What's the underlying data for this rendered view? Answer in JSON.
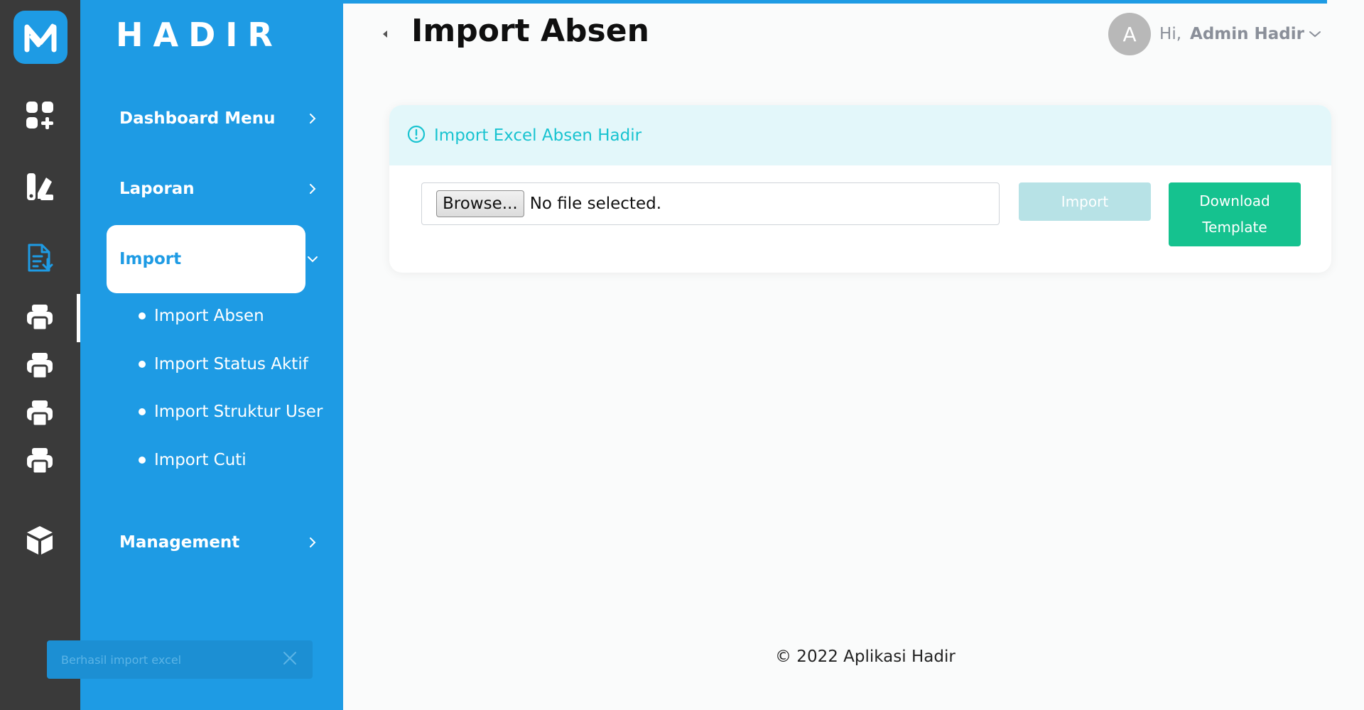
{
  "app": {
    "brand": "HADIR",
    "accent_color": "#1e9be4",
    "rail_color": "#3a3a3a"
  },
  "rail": {
    "icons": [
      "logo-icon",
      "dashboard-icon",
      "report-icon",
      "import-file-icon",
      "printer-icon",
      "printer-icon",
      "printer-icon",
      "printer-icon",
      "box-icon"
    ]
  },
  "sidebar": {
    "items": [
      {
        "label": "Dashboard Menu"
      },
      {
        "label": "Laporan"
      },
      {
        "label": "Import"
      },
      {
        "label": "Management"
      }
    ],
    "import_sub": [
      {
        "label": "Import Absen"
      },
      {
        "label": "Import Status Aktif"
      },
      {
        "label": "Import Struktur User"
      },
      {
        "label": "Import Cuti"
      }
    ]
  },
  "toast": {
    "message": "Berhasil import excel"
  },
  "header": {
    "title": "Import Absen",
    "avatar_initial": "A",
    "greeting": "Hi,",
    "user_name": "Admin Hadir"
  },
  "card": {
    "header_text": "Import Excel Absen Hadir",
    "browse_label": "Browse...",
    "file_status": "No file selected.",
    "import_label": "Import",
    "download_line1": "Download",
    "download_line2": "Template"
  },
  "footer": {
    "text": "© 2022 Aplikasi Hadir"
  }
}
